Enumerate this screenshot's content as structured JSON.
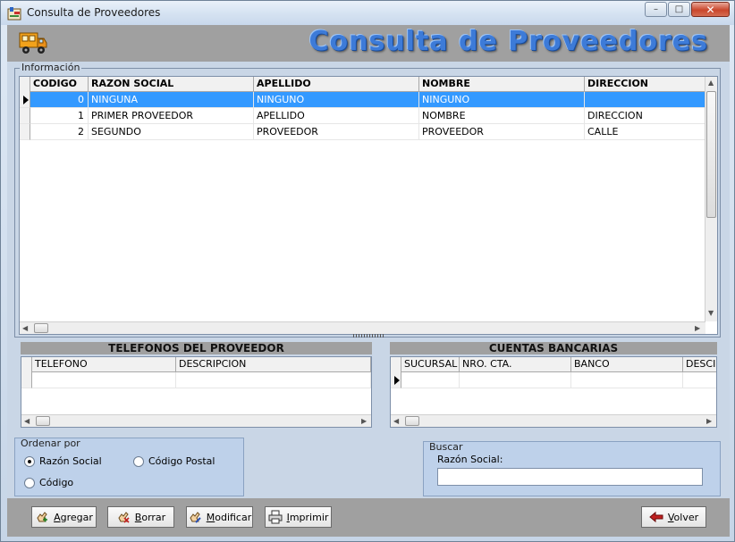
{
  "window": {
    "title": "Consulta de Proveedores",
    "minimize": "–",
    "maximize": "□",
    "close": "✕"
  },
  "header": {
    "banner": "Consulta de Proveedores"
  },
  "info_group": {
    "label": "Información",
    "columns": [
      "CODIGO",
      "RAZON SOCIAL",
      "APELLIDO",
      "NOMBRE",
      "DIRECCION"
    ],
    "rows": [
      {
        "codigo": "0",
        "razon": "NINGUNA",
        "apellido": "NINGUNO",
        "nombre": "NINGUNO",
        "direccion": "",
        "selected": true
      },
      {
        "codigo": "1",
        "razon": "PRIMER PROVEEDOR",
        "apellido": "APELLIDO",
        "nombre": "NOMBRE",
        "direccion": "DIRECCION"
      },
      {
        "codigo": "2",
        "razon": "SEGUNDO",
        "apellido": "PROVEEDOR",
        "nombre": "PROVEEDOR",
        "direccion": "CALLE"
      }
    ]
  },
  "telefonos": {
    "title": "TELEFONOS DEL PROVEEDOR",
    "columns": [
      "TELEFONO",
      "DESCRIPCION"
    ]
  },
  "cuentas": {
    "title": "CUENTAS BANCARIAS",
    "columns": [
      "SUCURSAL",
      "NRO. CTA.",
      "BANCO",
      "DESCI"
    ]
  },
  "ordenar": {
    "label": "Ordenar por",
    "options": [
      {
        "label": "Razón Social",
        "checked": true
      },
      {
        "label": "Código Postal",
        "checked": false
      },
      {
        "label": "Código",
        "checked": false
      }
    ]
  },
  "buscar": {
    "label": "Buscar",
    "field_label": "Razón Social:",
    "value": ""
  },
  "buttons": {
    "agregar": "Agregar",
    "borrar": "Borrar",
    "modificar": "Modificar",
    "imprimir": "Imprimir",
    "volver": "Volver"
  },
  "colors": {
    "selection": "#3399ff",
    "banner": "#3d7bd8",
    "strip": "#a0a0a0"
  }
}
